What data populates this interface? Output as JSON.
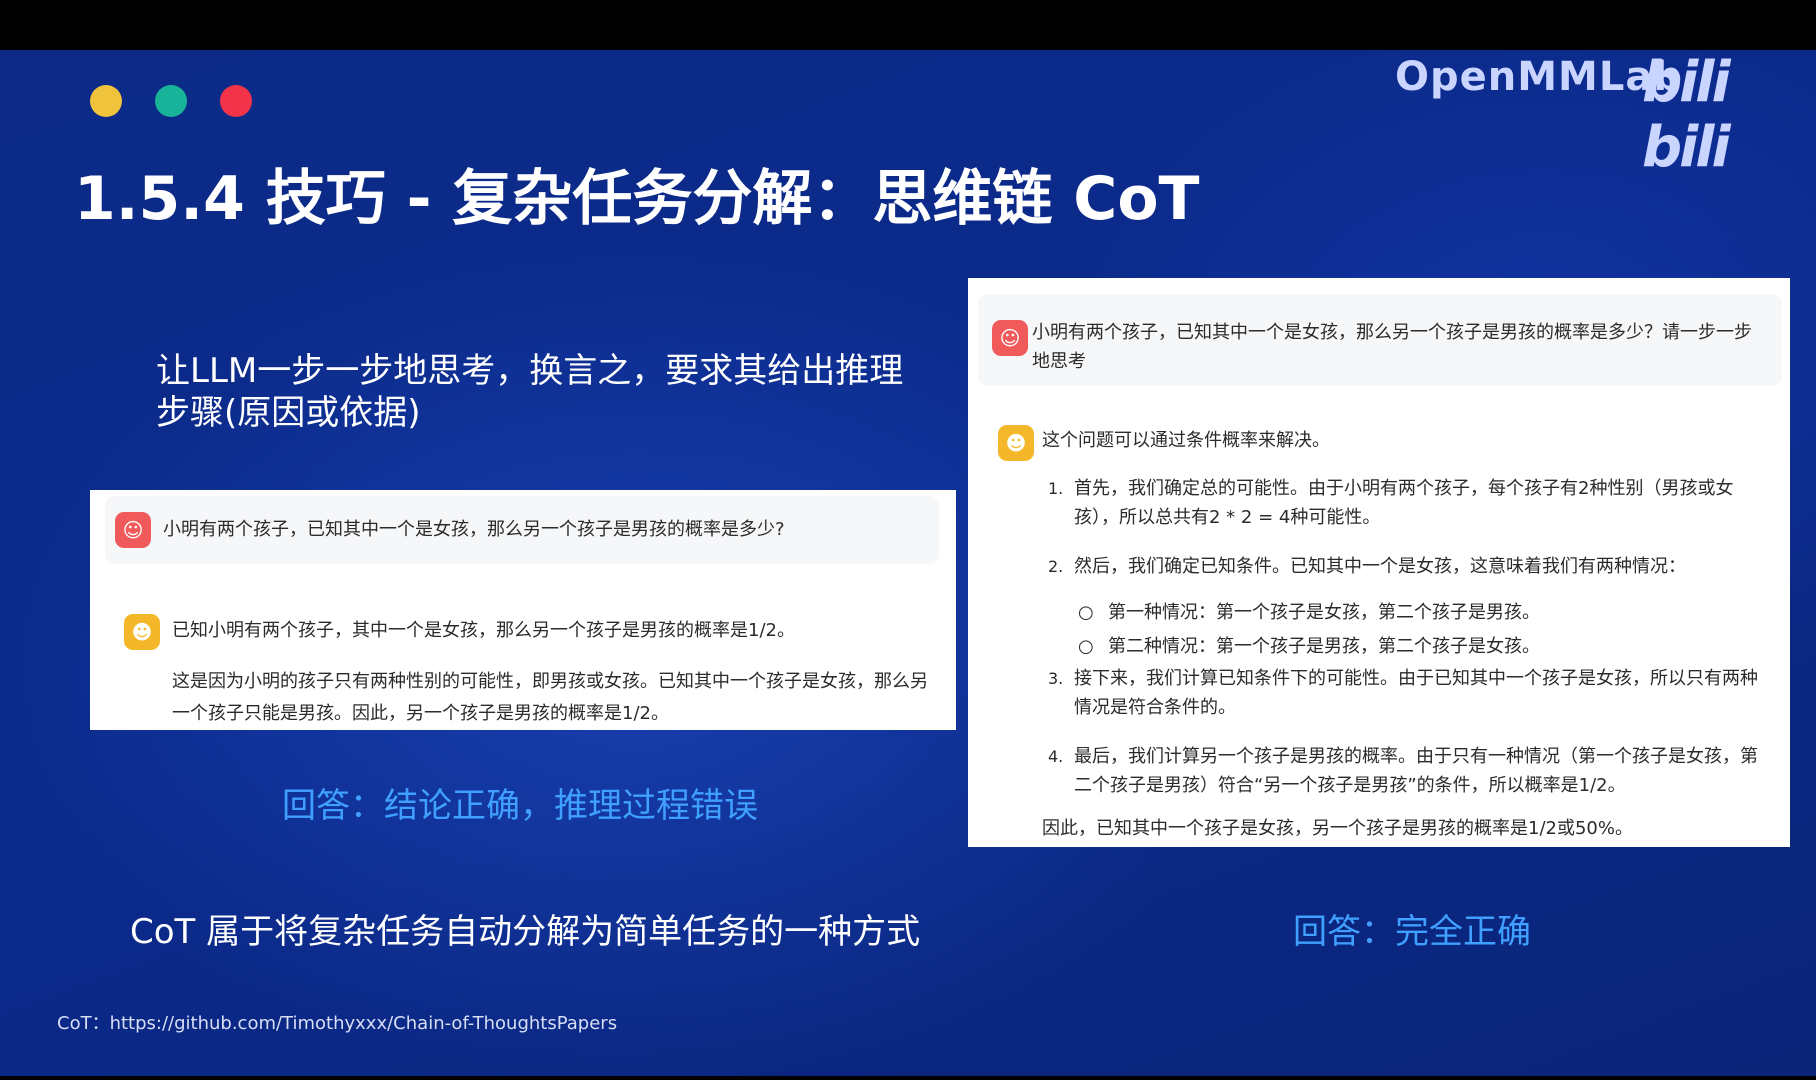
{
  "brand": {
    "name": "OpenMMLab",
    "platform": "bilibili"
  },
  "dots": {
    "colors": [
      "#f0c33c",
      "#19b39a",
      "#f2334a"
    ]
  },
  "slide": {
    "title": "1.5.4 技巧 - 复杂任务分解：思维链 CoT",
    "intro": "让LLM一步一步地思考，换言之，要求其给出推理步骤(原因或依据)",
    "answer_left": "回答：结论正确，推理过程错误",
    "answer_right": "回答：完全正确",
    "summary": "CoT 属于将复杂任务自动分解为简单任务的一种方式",
    "reference": "CoT：https://github.com/Timothyxxx/Chain-of-ThoughtsPapers"
  },
  "left_chat": {
    "question": "小明有两个孩子，已知其中一个是女孩，那么另一个孩子是男孩的概率是多少?",
    "answer_line1": "已知小明有两个孩子，其中一个是女孩，那么另一个孩子是男孩的概率是1/2。",
    "answer_para": "这是因为小明的孩子只有两种性别的可能性，即男孩或女孩。已知其中一个孩子是女孩，那么另一个孩子只能是男孩。因此，另一个孩子是男孩的概率是1/2。"
  },
  "right_chat": {
    "question": "小明有两个孩子，已知其中一个是女孩，那么另一个孩子是男孩的概率是多少？请一步一步地思考",
    "answer_intro": "这个问题可以通过条件概率来解决。",
    "steps": [
      {
        "num": "1.",
        "text": "首先，我们确定总的可能性。由于小明有两个孩子，每个孩子有2种性别（男孩或女孩），所以总共有2 * 2 = 4种可能性。"
      },
      {
        "num": "2.",
        "text": "然后，我们确定已知条件。已知其中一个是女孩，这意味着我们有两种情况："
      },
      {
        "num": "3.",
        "text": "接下来，我们计算已知条件下的可能性。由于已知其中一个孩子是女孩，所以只有两种情况是符合条件的。"
      },
      {
        "num": "4.",
        "text": "最后，我们计算另一个孩子是男孩的概率。由于只有一种情况（第一个孩子是女孩，第二个孩子是男孩）符合“另一个孩子是男孩”的条件，所以概率是1/2。"
      }
    ],
    "sub_items": [
      {
        "bullet": "○",
        "text": "第一种情况：第一个孩子是女孩，第二个孩子是男孩。"
      },
      {
        "bullet": "○",
        "text": "第二种情况：第一个孩子是男孩，第二个孩子是女孩。"
      }
    ],
    "conclusion": "因此，已知其中一个孩子是女孩，另一个孩子是男孩的概率是1/2或50%。"
  }
}
